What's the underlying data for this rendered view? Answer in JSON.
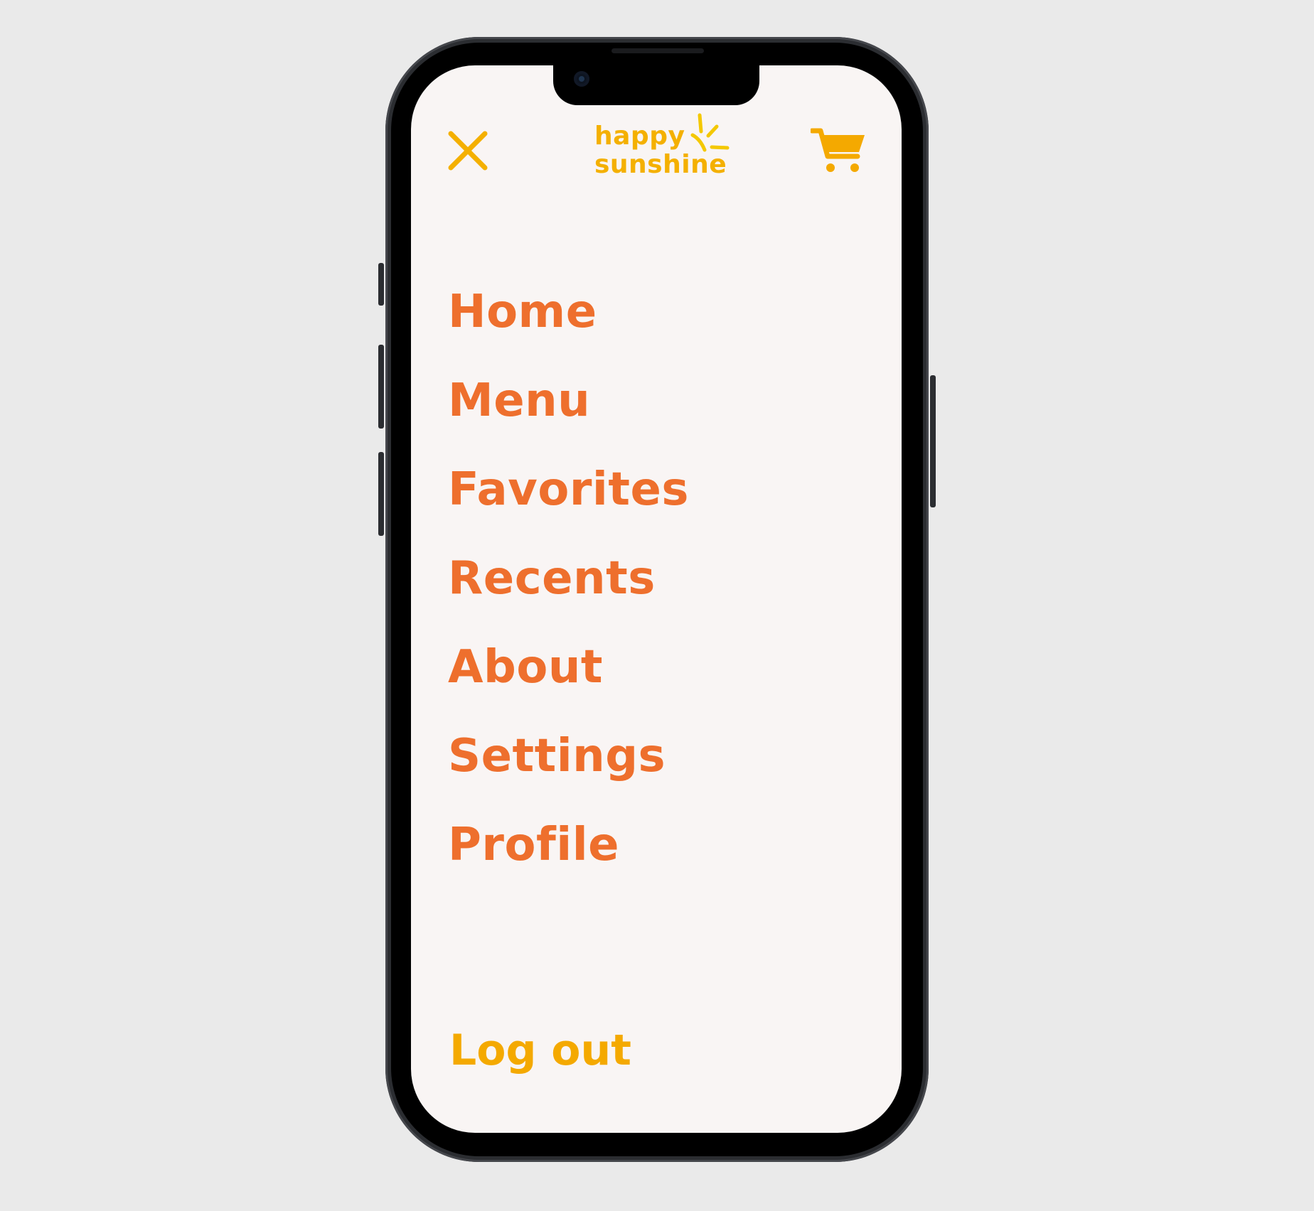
{
  "header": {
    "close_icon": "close-icon",
    "logo": {
      "line1": "happy",
      "line2": "sunshine"
    },
    "cart_icon": "cart-icon"
  },
  "nav": {
    "items": [
      {
        "label": "Home"
      },
      {
        "label": "Menu"
      },
      {
        "label": "Favorites"
      },
      {
        "label": "Recents"
      },
      {
        "label": "About"
      },
      {
        "label": "Settings"
      },
      {
        "label": "Profile"
      }
    ]
  },
  "footer": {
    "logout_label": "Log out"
  },
  "colors": {
    "nav_text": "#EE6F2D",
    "accent_yellow": "#F4B000",
    "logout_text": "#F4A900",
    "screen_bg": "#F9F5F4",
    "page_bg": "#EAEAEA"
  }
}
